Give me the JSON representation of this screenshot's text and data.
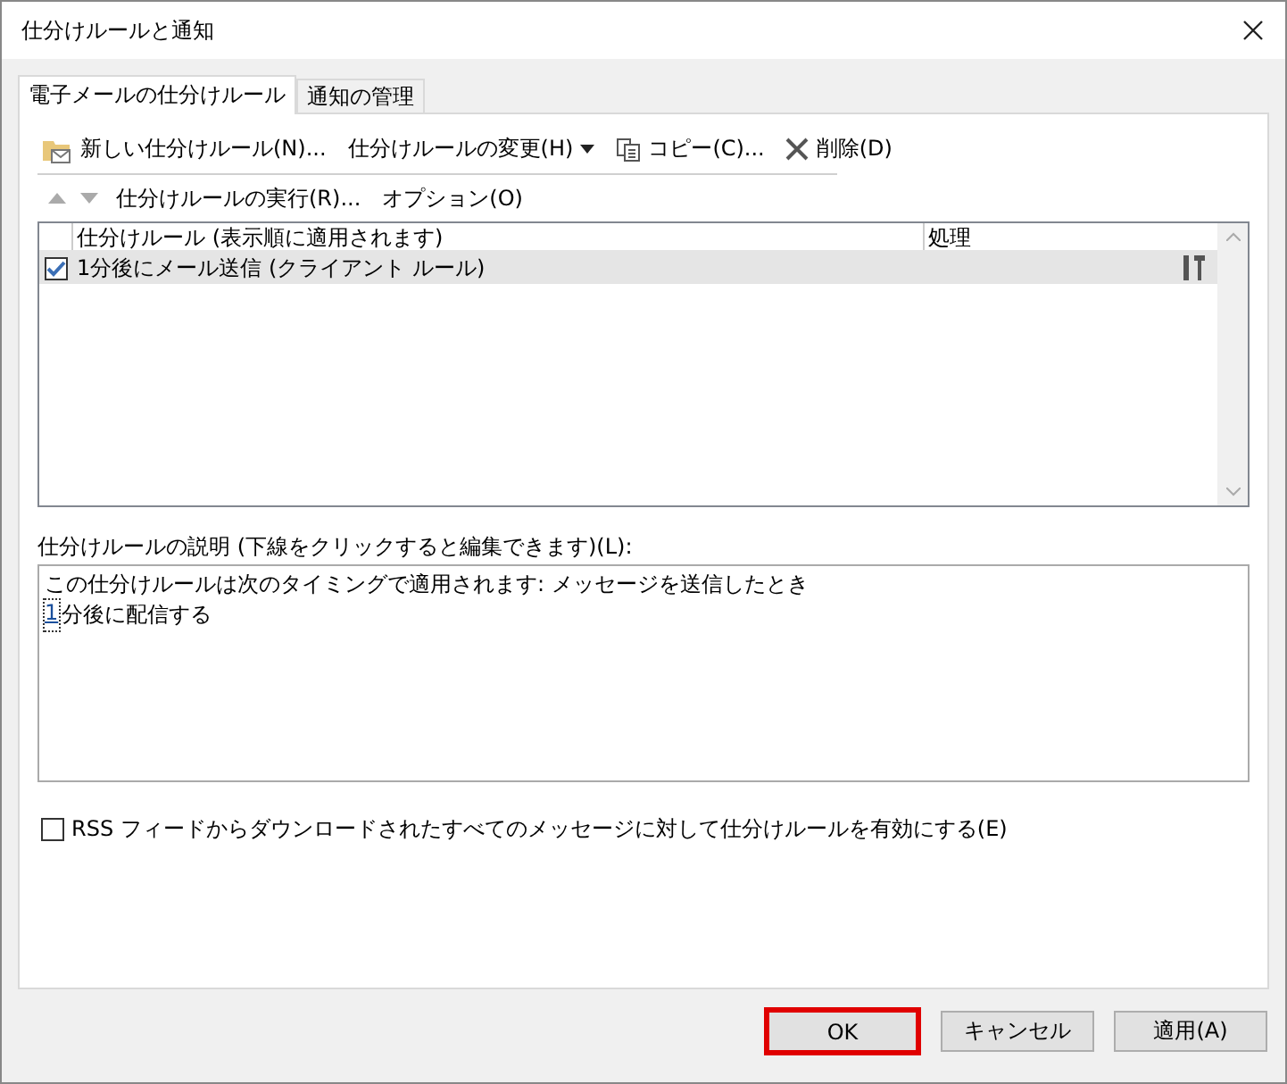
{
  "window": {
    "title": "仕分けルールと通知"
  },
  "tabs": [
    {
      "label": "電子メールの仕分けルール",
      "selected": true
    },
    {
      "label": "通知の管理",
      "selected": false
    }
  ],
  "toolbar": [
    {
      "kind": "new",
      "label": "新しい仕分けルール(N)..."
    },
    {
      "kind": "change",
      "label": "仕分けルールの変更(H)"
    },
    {
      "kind": "copy",
      "label": "コピー(C)..."
    },
    {
      "kind": "delete",
      "label": "削除(D)"
    }
  ],
  "toolbar2": {
    "run": "仕分けルールの実行(R)...",
    "options": "オプション(O)"
  },
  "table": {
    "columns": [
      "仕分けルール (表示順に適用されます)",
      "処理"
    ],
    "rows": [
      {
        "name": "1分後にメール送信 (クライアント ルール)",
        "checked": true,
        "selected": true
      }
    ]
  },
  "description": {
    "label": "仕分けルールの説明 (下線をクリックすると編集できます)(L):",
    "line1": "この仕分けルールは次のタイミングで適用されます: メッセージを送信したとき",
    "link": "1",
    "line2": "分後に配信する"
  },
  "rss": {
    "label": "RSS フィードからダウンロードされたすべてのメッセージに対して仕分けルールを有効にする(E)",
    "checked": false
  },
  "buttons": [
    {
      "label": "OK",
      "highlighted": true
    },
    {
      "label": "キャンセル",
      "highlighted": false
    },
    {
      "label": "適用(A)",
      "highlighted": false
    }
  ]
}
